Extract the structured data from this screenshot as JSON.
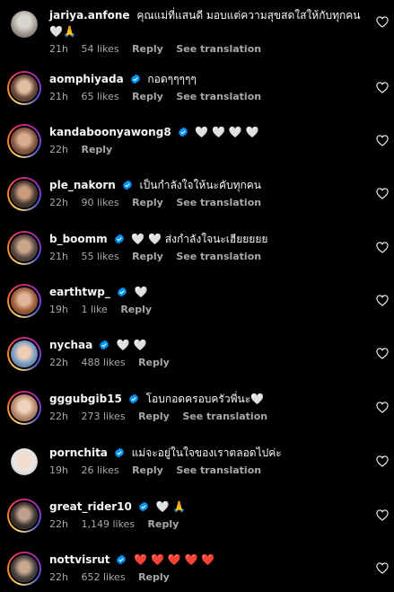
{
  "colors": {
    "background": "#000000",
    "text": "#f5f5f5",
    "muted": "#a8a8a8",
    "verified": "#0095f6",
    "red_heart": "#ed4956"
  },
  "icons": {
    "like": "heart-outline-icon",
    "verified": "verified-badge-icon"
  },
  "comments": [
    {
      "username": "jariya.anfone",
      "verified": false,
      "text": "คุณแม่ที่แสนดี มอบแต่ความสุขสดใสให้กับทุกคน 🤍🙏",
      "time": "21h",
      "likes": "54 likes",
      "reply": "Reply",
      "translate": "See translation"
    },
    {
      "username": "aomphiyada",
      "verified": true,
      "text": "กอดๆๆๆๆๆ",
      "time": "21h",
      "likes": "65 likes",
      "reply": "Reply",
      "translate": "See translation"
    },
    {
      "username": "kandaboonyawong8",
      "verified": true,
      "text": "🤍 🤍 🤍 🤍",
      "time": "22h",
      "likes": "",
      "reply": "Reply",
      "translate": ""
    },
    {
      "username": "ple_nakorn",
      "verified": true,
      "text": "เป็นกำลังใจให้นะคับทุกคน",
      "time": "22h",
      "likes": "90 likes",
      "reply": "Reply",
      "translate": "See translation"
    },
    {
      "username": "b_boomm",
      "verified": true,
      "text": "🤍 🤍 ส่งกำลังใจนะเฮียยยยย",
      "time": "21h",
      "likes": "55 likes",
      "reply": "Reply",
      "translate": "See translation"
    },
    {
      "username": "earthtwp_",
      "verified": true,
      "text": "🤍",
      "time": "19h",
      "likes": "1 like",
      "reply": "Reply",
      "translate": ""
    },
    {
      "username": "nychaa",
      "verified": true,
      "text": "🤍 🤍",
      "time": "22h",
      "likes": "488 likes",
      "reply": "Reply",
      "translate": ""
    },
    {
      "username": "gggubgib15",
      "verified": true,
      "text": "โอบกอดครอบครัวพี่นะ🤍",
      "time": "22h",
      "likes": "273 likes",
      "reply": "Reply",
      "translate": "See translation"
    },
    {
      "username": "pornchita",
      "verified": true,
      "text": "แม่จะอยู่ในใจของเราตลอดไปค่ะ",
      "time": "19h",
      "likes": "26 likes",
      "reply": "Reply",
      "translate": "See translation"
    },
    {
      "username": "great_rider10",
      "verified": true,
      "text": "🤍 🙏",
      "time": "22h",
      "likes": "1,149 likes",
      "reply": "Reply",
      "translate": ""
    },
    {
      "username": "nottvisrut",
      "verified": true,
      "text": "❤️ ❤️ ❤️ ❤️ ❤️",
      "time": "22h",
      "likes": "652 likes",
      "reply": "Reply",
      "translate": ""
    }
  ]
}
